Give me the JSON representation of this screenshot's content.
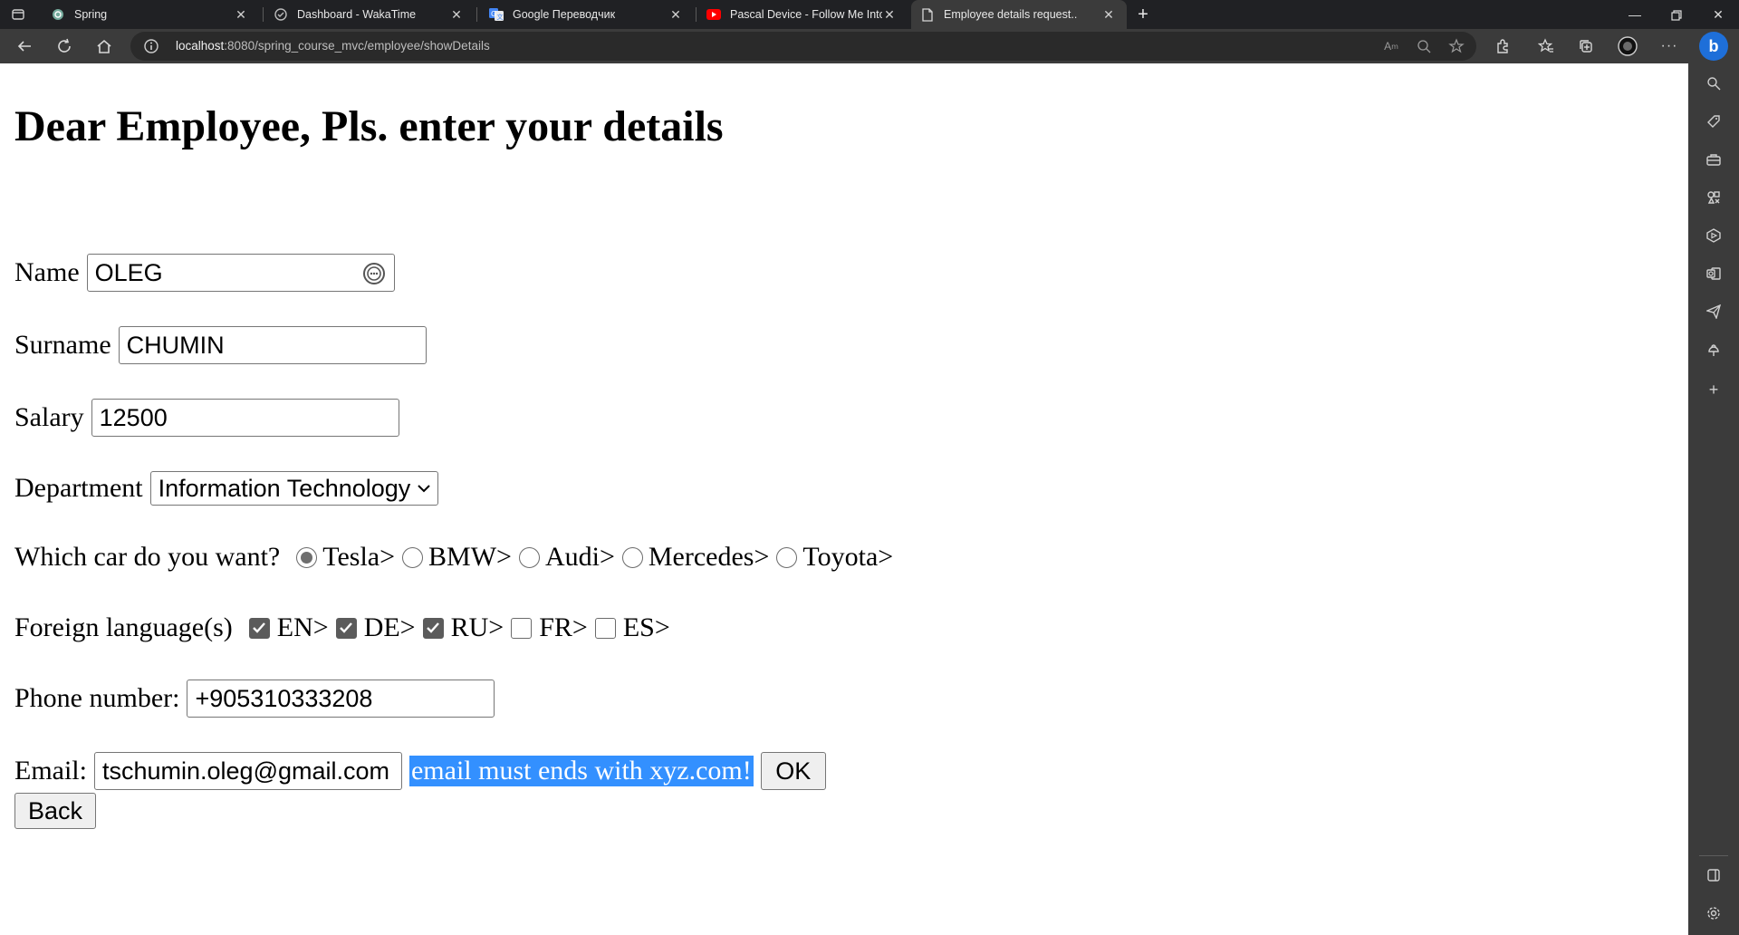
{
  "browser": {
    "tabs": [
      {
        "title": "Spring",
        "icon": "chatgpt-icon"
      },
      {
        "title": "Dashboard - WakaTime",
        "icon": "wakatime-icon"
      },
      {
        "title": "Google Переводчик",
        "icon": "google-translate-icon"
      },
      {
        "title": "Pascal Device - Follow Me Into Th",
        "icon": "youtube-icon"
      },
      {
        "title": "Employee details request..",
        "icon": "page-icon"
      }
    ],
    "address": {
      "host": "localhost",
      "path": ":8080/spring_course_mvc/employee/showDetails"
    },
    "accent_color": "#1e6fd9"
  },
  "page": {
    "heading": "Dear Employee, Pls. enter your details",
    "name": {
      "label": "Name",
      "value": "OLEG"
    },
    "surname": {
      "label": "Surname",
      "value": "CHUMIN"
    },
    "salary": {
      "label": "Salary",
      "value": "12500"
    },
    "department": {
      "label": "Department",
      "selected": "Information Technology"
    },
    "car": {
      "label": "Which car do you want?",
      "options": [
        "Tesla>",
        "BMW>",
        "Audi>",
        "Mercedes>",
        "Toyota>"
      ],
      "selected": "Tesla>"
    },
    "languages": {
      "label": "Foreign language(s)",
      "options": [
        "EN>",
        "DE>",
        "RU>",
        "FR>",
        "ES>"
      ],
      "checked": [
        "EN>",
        "DE>",
        "RU>"
      ]
    },
    "phone": {
      "label": "Phone number:",
      "value": "+905310333208"
    },
    "email": {
      "label": "Email:",
      "value": "tschumin.oleg@gmail.com",
      "error": "email must ends with xyz.com!",
      "highlight_color": "#3390ff"
    },
    "ok_button": "OK",
    "back_button": "Back"
  }
}
